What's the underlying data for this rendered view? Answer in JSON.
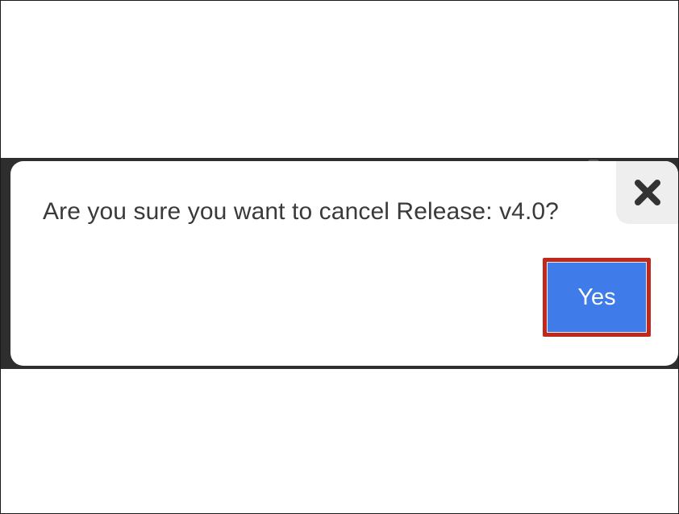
{
  "dialog": {
    "message": "Are you sure you want to cancel Release: v4.0?",
    "close_icon": "close-icon",
    "confirm_label": "Yes"
  },
  "colors": {
    "confirm_button": "#3f7be9",
    "highlight_border": "#c0281b",
    "close_button_bg": "#eeeeee",
    "backdrop": "#2e2e2e"
  }
}
